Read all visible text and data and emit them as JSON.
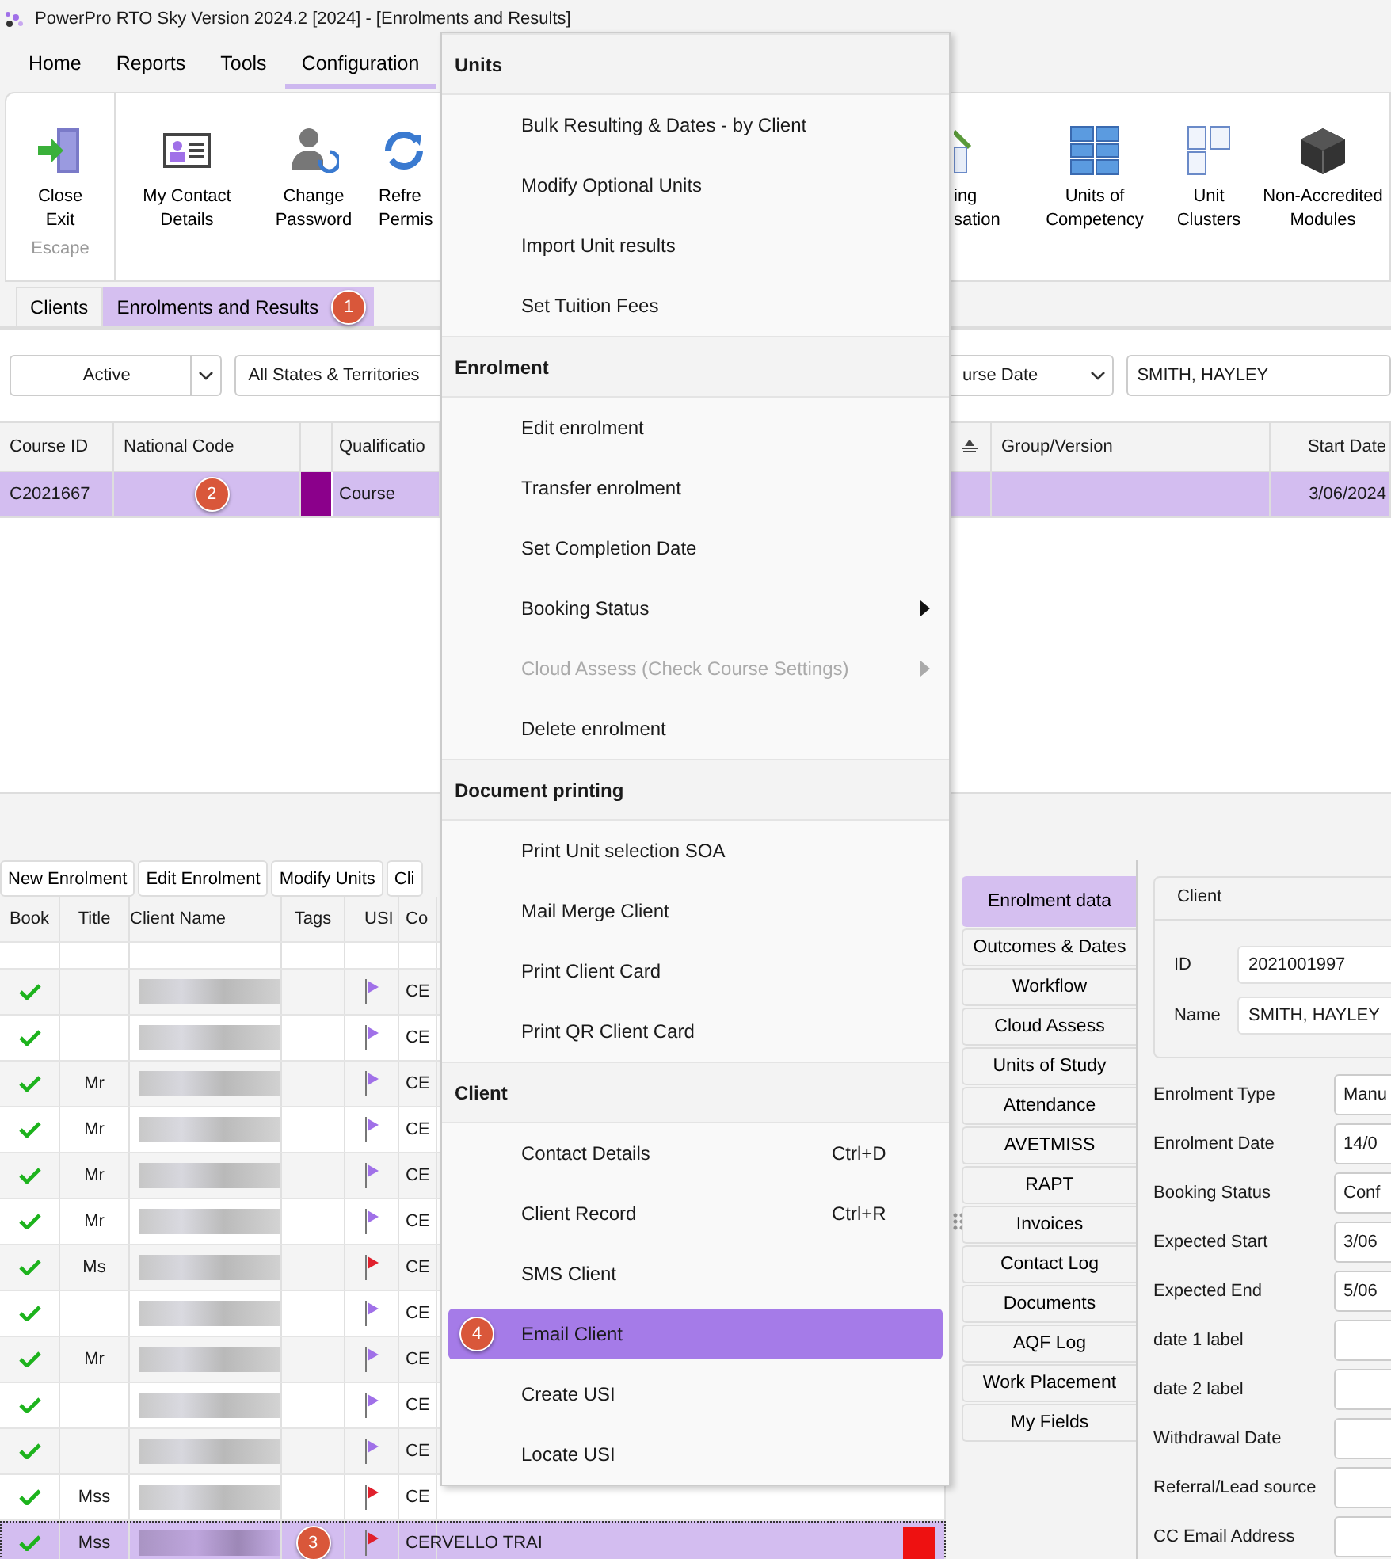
{
  "window": {
    "title": "PowerPro RTO Sky Version 2024.2 [2024] - [Enrolments and Results]"
  },
  "menu_tabs": [
    {
      "label": "Home",
      "selected": false
    },
    {
      "label": "Reports",
      "selected": false
    },
    {
      "label": "Tools",
      "selected": false
    },
    {
      "label": "Configuration",
      "selected": true
    }
  ],
  "ribbon_left": [
    {
      "kind": "exit",
      "lines": [
        "Close",
        "Exit"
      ],
      "caption": "Escape"
    }
  ],
  "ribbon": [
    {
      "kind": "card",
      "lines": [
        "My Contact",
        "Details"
      ]
    },
    {
      "kind": "person",
      "lines": [
        "Change",
        "Password"
      ]
    },
    {
      "kind": "refresh",
      "lines": [
        "Refre",
        "Permis"
      ]
    }
  ],
  "ribbon_right": [
    {
      "kind": "pencil",
      "lines": [
        "ing",
        "sation"
      ]
    },
    {
      "kind": "grid",
      "lines": [
        "Units of",
        "Competency"
      ]
    },
    {
      "kind": "clusters",
      "lines": [
        "Unit",
        "Clusters"
      ]
    },
    {
      "kind": "cube",
      "lines": [
        "Non-Accredited",
        "Modules"
      ]
    }
  ],
  "doc_tabs": [
    {
      "label": "Clients",
      "selected": false
    },
    {
      "label": "Enrolments and Results",
      "selected": true,
      "badge": "1"
    }
  ],
  "filters": {
    "status": "Active",
    "states": "All States & Territories",
    "date": "urse Date",
    "client": "SMITH, HAYLEY"
  },
  "course_grid": {
    "columns_left": [
      "Course ID",
      "National Code",
      "Qualificatio"
    ],
    "columns_right": [
      "Group/Version",
      "Start Date"
    ],
    "rows": [
      {
        "course_id": "C2021667",
        "badge": "2",
        "color": "#8b008b",
        "qualification": "Course",
        "start_date": "3/06/2024",
        "selected": true
      }
    ]
  },
  "lower_buttons": [
    "New Enrolment",
    "Edit Enrolment",
    "Modify Units",
    "Cli"
  ],
  "client_grid": {
    "columns": [
      "Book",
      "Title",
      "Client Name",
      "Tags",
      "USI",
      "Co"
    ],
    "rows": [
      {
        "booked": true,
        "title": "",
        "color": "#a070e8",
        "course": "CE",
        "selected": false
      },
      {
        "booked": true,
        "title": "",
        "color": "#a070e8",
        "course": "CE",
        "selected": false
      },
      {
        "booked": true,
        "title": "Mr",
        "color": "#a070e8",
        "course": "CE",
        "selected": false
      },
      {
        "booked": true,
        "title": "Mr",
        "color": "#a070e8",
        "course": "CE",
        "selected": false
      },
      {
        "booked": true,
        "title": "Mr",
        "color": "#a070e8",
        "course": "CE",
        "selected": false
      },
      {
        "booked": true,
        "title": "Mr",
        "color": "#a070e8",
        "course": "CE",
        "selected": false
      },
      {
        "booked": true,
        "title": "Ms",
        "color": "#e0202c",
        "course": "CE",
        "selected": false
      },
      {
        "booked": true,
        "title": "",
        "color": "#a070e8",
        "course": "CE",
        "selected": false
      },
      {
        "booked": true,
        "title": "Mr",
        "color": "#a070e8",
        "course": "CE",
        "selected": false
      },
      {
        "booked": true,
        "title": "",
        "color": "#a070e8",
        "course": "CE",
        "selected": false
      },
      {
        "booked": true,
        "title": "",
        "color": "#a070e8",
        "course": "CE",
        "selected": false
      },
      {
        "booked": true,
        "title": "Mss",
        "color": "#e0202c",
        "course": "CE",
        "selected": false
      },
      {
        "booked": true,
        "title": "Mss",
        "color": "#e0202c",
        "course": "CERVELLO TRAI",
        "selected": true,
        "badge": "3"
      }
    ]
  },
  "side_tabs": [
    {
      "label": "Enrolment data",
      "selected": true
    },
    {
      "label": "Outcomes & Dates",
      "selected": false
    },
    {
      "label": "Workflow",
      "selected": false
    },
    {
      "label": "Cloud Assess",
      "selected": false
    },
    {
      "label": "Units of Study",
      "selected": false
    },
    {
      "label": "Attendance",
      "selected": false
    },
    {
      "label": "AVETMISS",
      "selected": false
    },
    {
      "label": "RAPT",
      "selected": false
    },
    {
      "label": "Invoices",
      "selected": false
    },
    {
      "label": "Contact Log",
      "selected": false
    },
    {
      "label": "Documents",
      "selected": false
    },
    {
      "label": "AQF Log",
      "selected": false
    },
    {
      "label": "Work Placement",
      "selected": false
    },
    {
      "label": "My Fields",
      "selected": false
    }
  ],
  "client_box": {
    "title": "Client",
    "id_label": "ID",
    "id": "2021001997",
    "name_label": "Name",
    "name": "SMITH, HAYLEY"
  },
  "fields": [
    {
      "label": "Enrolment Type",
      "value": "Manu"
    },
    {
      "label": "Enrolment Date",
      "value": "14/0"
    },
    {
      "label": "Booking Status",
      "value": "Conf"
    },
    {
      "label": "Expected Start",
      "value": "3/06"
    },
    {
      "label": "Expected End",
      "value": "5/06"
    },
    {
      "label": "date 1 label"
    },
    {
      "label": "date 2 label"
    },
    {
      "label": "Withdrawal Date"
    },
    {
      "label": "Referral/Lead source"
    },
    {
      "label": "CC Email Address"
    }
  ],
  "context_menu": [
    {
      "header": "Units",
      "items": [
        {
          "label": "Bulk Resulting & Dates - by Client",
          "disabled": false,
          "submenu": false,
          "selected": false
        },
        {
          "label": "Modify Optional Units",
          "disabled": false,
          "submenu": false,
          "selected": false
        },
        {
          "label": "Import Unit results",
          "disabled": false,
          "submenu": false,
          "selected": false
        },
        {
          "label": "Set Tuition Fees",
          "disabled": false,
          "submenu": false,
          "selected": false
        }
      ]
    },
    {
      "header": "Enrolment",
      "items": [
        {
          "label": "Edit enrolment",
          "disabled": false,
          "submenu": false,
          "selected": false
        },
        {
          "label": "Transfer enrolment",
          "disabled": false,
          "submenu": false,
          "selected": false
        },
        {
          "label": "Set Completion Date",
          "disabled": false,
          "submenu": false,
          "selected": false
        },
        {
          "label": "Booking Status",
          "disabled": false,
          "submenu": true,
          "selected": false
        },
        {
          "label": "Cloud Assess (Check Course Settings)",
          "disabled": true,
          "submenu": true,
          "selected": false
        },
        {
          "label": "Delete enrolment",
          "disabled": false,
          "submenu": false,
          "selected": false
        }
      ]
    },
    {
      "header": "Document printing",
      "items": [
        {
          "label": "Print Unit selection SOA",
          "disabled": false,
          "submenu": false,
          "selected": false
        },
        {
          "label": "Mail Merge Client",
          "disabled": false,
          "submenu": false,
          "selected": false
        },
        {
          "label": "Print Client Card",
          "disabled": false,
          "submenu": false,
          "selected": false
        },
        {
          "label": "Print QR Client Card",
          "disabled": false,
          "submenu": false,
          "selected": false
        }
      ]
    },
    {
      "header": "Client",
      "items": [
        {
          "label": "Contact Details",
          "shortcut": "Ctrl+D",
          "disabled": false,
          "submenu": false,
          "selected": false
        },
        {
          "label": "Client Record",
          "shortcut": "Ctrl+R",
          "disabled": false,
          "submenu": false,
          "selected": false
        },
        {
          "label": "SMS Client",
          "disabled": false,
          "submenu": false,
          "selected": false
        },
        {
          "label": "Email Client",
          "badge": "4",
          "disabled": false,
          "submenu": false,
          "selected": true
        },
        {
          "label": "Create USI",
          "disabled": false,
          "submenu": false,
          "selected": false
        },
        {
          "label": "Locate USI",
          "disabled": false,
          "submenu": false,
          "selected": false
        }
      ]
    }
  ]
}
